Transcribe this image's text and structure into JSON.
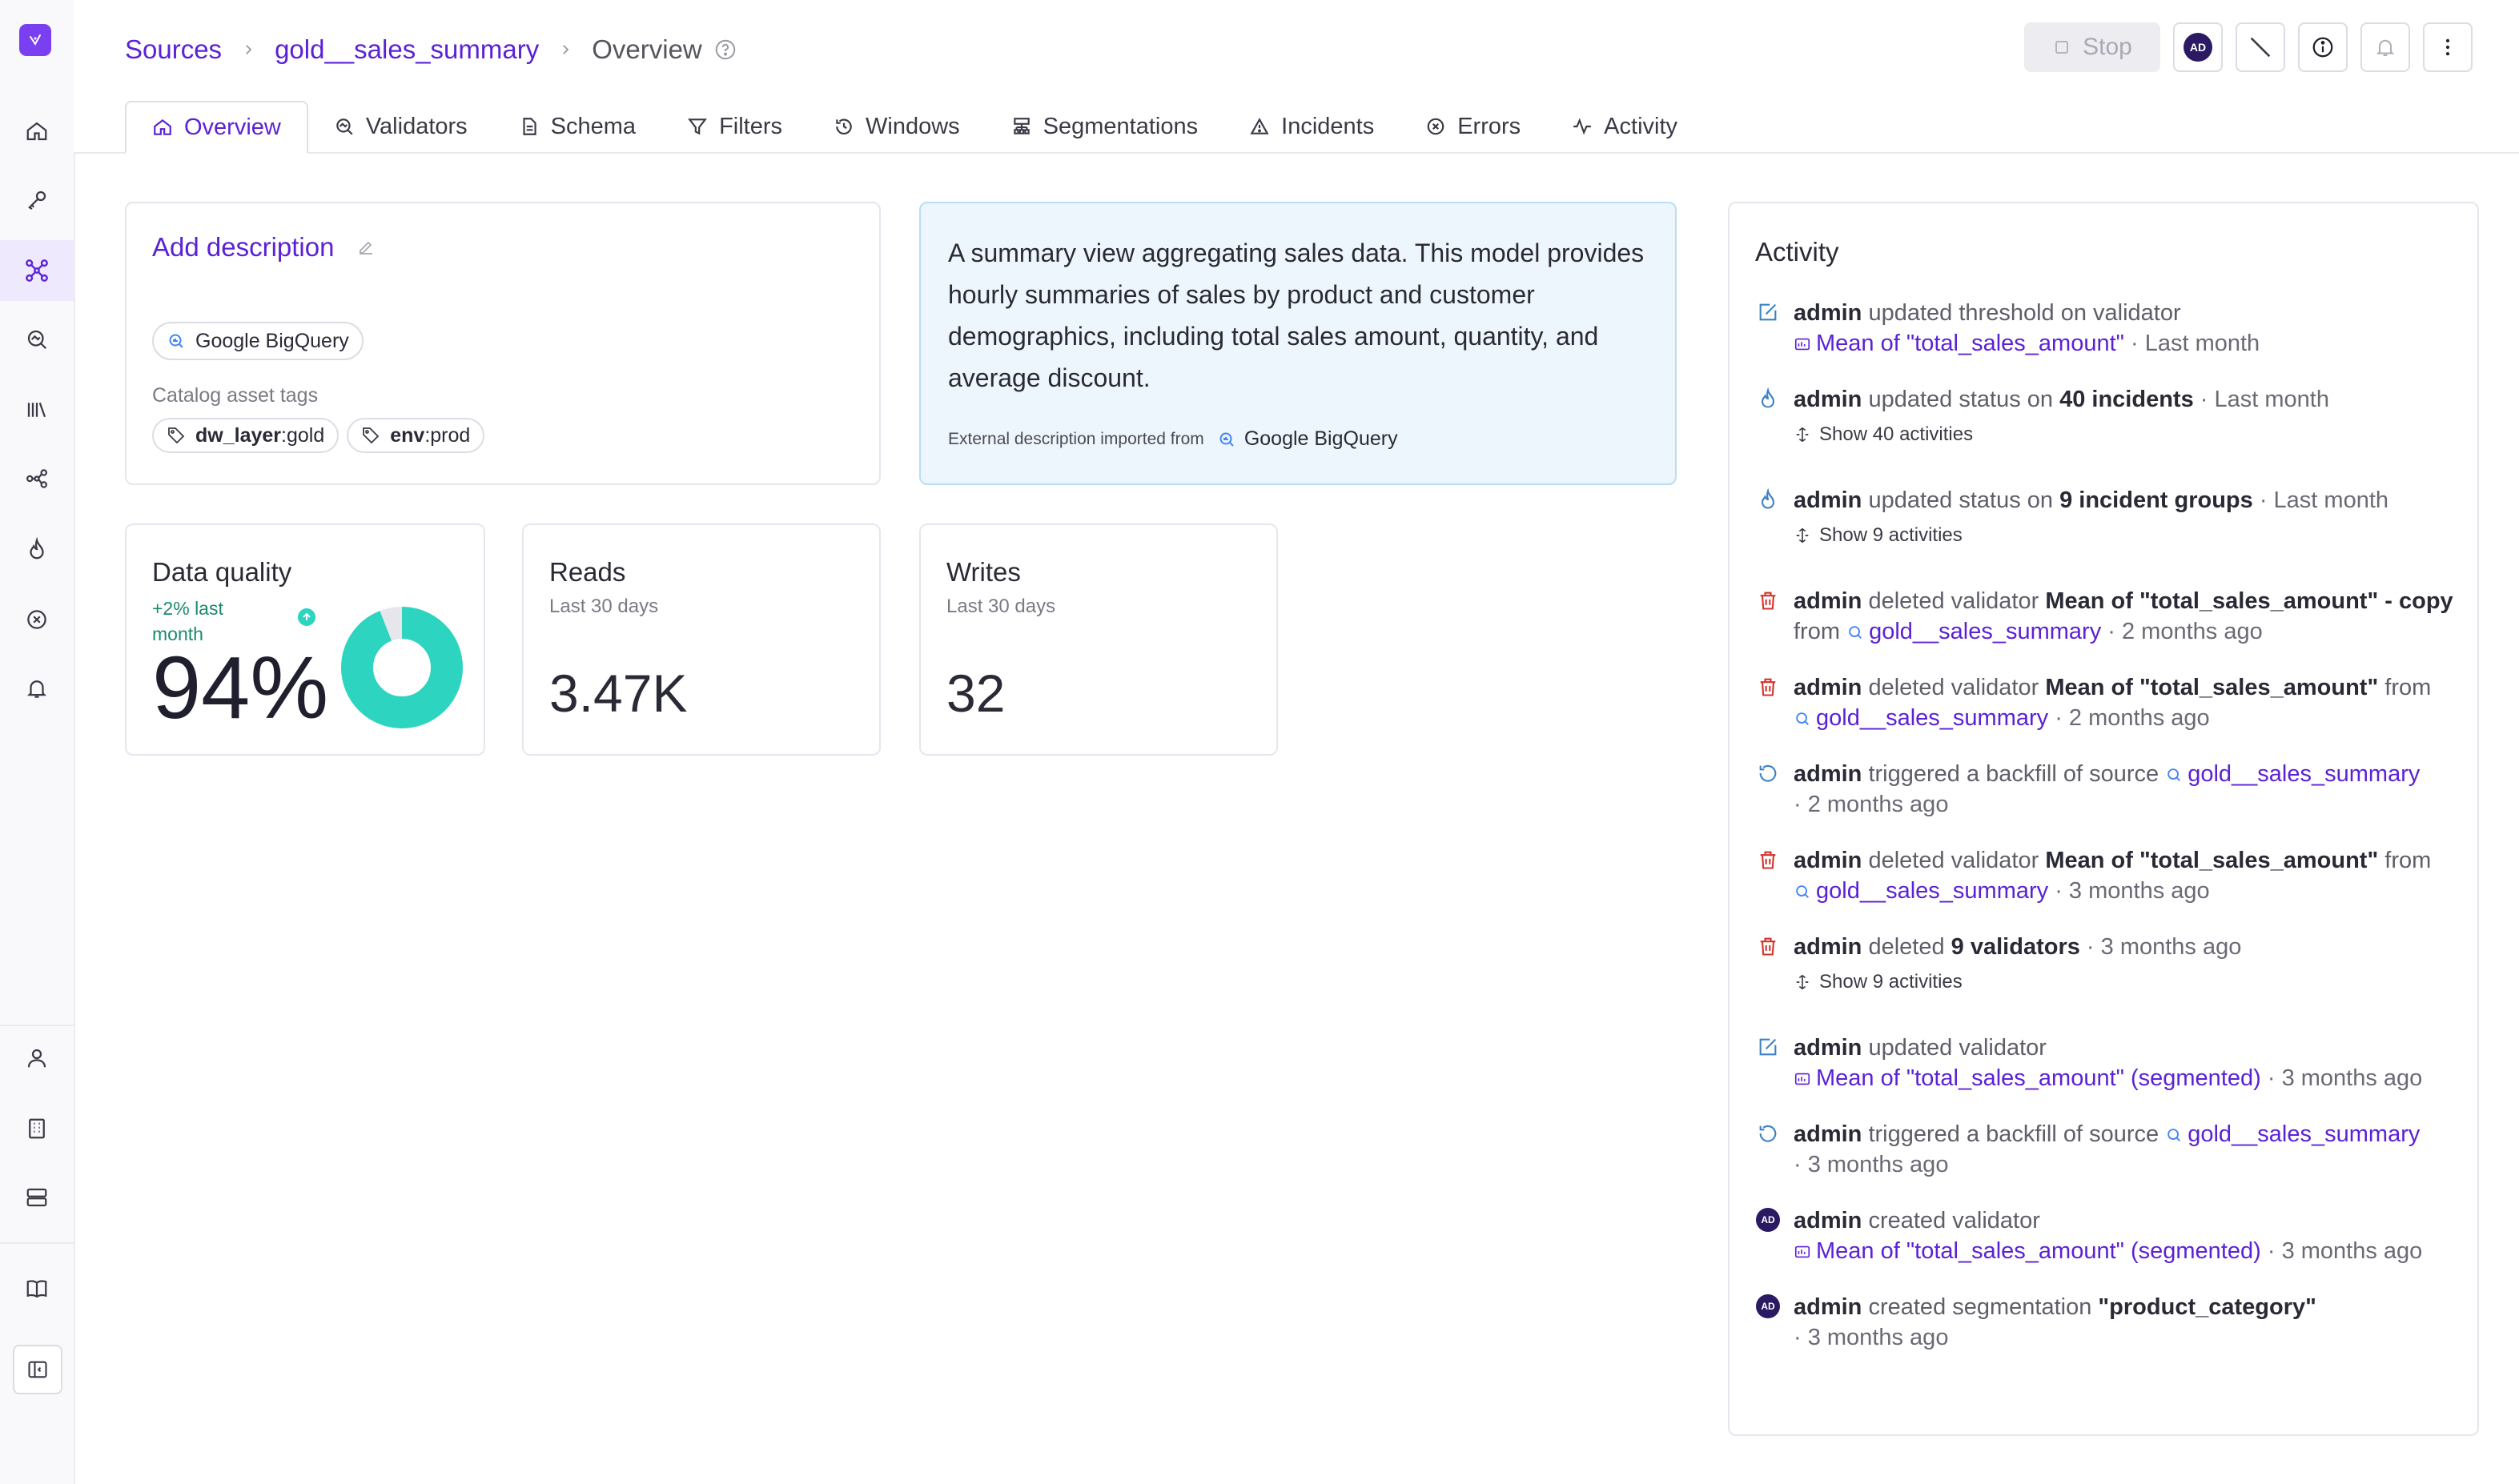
{
  "breadcrumb": {
    "root": "Sources",
    "source": "gold__sales_summary",
    "current": "Overview"
  },
  "header": {
    "stop_label": "Stop",
    "avatar_initials": "AD"
  },
  "tabs": [
    {
      "label": "Overview",
      "icon": "home-icon",
      "active": true
    },
    {
      "label": "Validators",
      "icon": "validator-icon"
    },
    {
      "label": "Schema",
      "icon": "schema-icon"
    },
    {
      "label": "Filters",
      "icon": "filter-icon"
    },
    {
      "label": "Windows",
      "icon": "windows-icon"
    },
    {
      "label": "Segmentations",
      "icon": "segmentation-icon"
    },
    {
      "label": "Incidents",
      "icon": "warning-icon"
    },
    {
      "label": "Errors",
      "icon": "error-icon"
    },
    {
      "label": "Activity",
      "icon": "activity-icon"
    }
  ],
  "description_card": {
    "add_label": "Add description",
    "source_chip": "Google BigQuery",
    "tags_label": "Catalog asset tags",
    "tags": [
      {
        "key": "dw_layer",
        "sep": ":",
        "value": "gold"
      },
      {
        "key": "env",
        "sep": ":",
        "value": "prod"
      }
    ]
  },
  "external_description": {
    "text": "A summary view aggregating sales data. This model provides hourly summaries of sales by product and customer demographics, including total sales amount, quantity, and average discount.",
    "imported_label": "External description imported from",
    "imported_source": "Google BigQuery"
  },
  "data_quality": {
    "title": "Data quality",
    "trend": "+2% last month",
    "value": "94%",
    "fraction": 0.94,
    "color": "#2dd4bf"
  },
  "reads": {
    "title": "Reads",
    "subtitle": "Last 30 days",
    "value": "3.47K"
  },
  "writes": {
    "title": "Writes",
    "subtitle": "Last 30 days",
    "value": "32"
  },
  "activity": {
    "title": "Activity",
    "items": {
      "a1": {
        "user": "admin",
        "action": " updated threshold on validator",
        "link": "Mean of \"total_sales_amount\"",
        "time": " · Last month"
      },
      "a2": {
        "user": "admin",
        "action": " updated status on ",
        "target": "40 incidents",
        "time": " · Last month",
        "show": "Show 40 activities"
      },
      "a3": {
        "user": "admin",
        "action": " updated status on ",
        "target": "9 incident groups",
        "time": " · Last month",
        "show": "Show 9 activities"
      },
      "a4": {
        "user": "admin",
        "action": " deleted validator ",
        "target": "Mean of \"total_sales_amount\" - copy",
        "from": "from ",
        "link": "gold__sales_summary",
        "time": " · 2 months ago"
      },
      "a5": {
        "user": "admin",
        "action": " deleted validator ",
        "target": "Mean of \"total_sales_amount\"",
        "from": " from",
        "link": "gold__sales_summary",
        "time": " · 2 months ago"
      },
      "a6": {
        "user": "admin",
        "action": " triggered a backfill of source ",
        "link": "gold__sales_summary",
        "time": "· 2 months ago"
      },
      "a7": {
        "user": "admin",
        "action": " deleted validator ",
        "target": "Mean of \"total_sales_amount\"",
        "from": " from",
        "link": "gold__sales_summary",
        "time": " · 3 months ago"
      },
      "a8": {
        "user": "admin",
        "action": " deleted ",
        "target": "9 validators",
        "time": " · 3 months ago",
        "show": "Show 9 activities"
      },
      "a9": {
        "user": "admin",
        "action": " updated validator",
        "link": "Mean of \"total_sales_amount\" (segmented)",
        "time": " · 3 months ago"
      },
      "a10": {
        "user": "admin",
        "action": " triggered a backfill of source ",
        "link": "gold__sales_summary",
        "time": "· 3 months ago"
      },
      "a11": {
        "user": "admin",
        "action": " created validator",
        "link": "Mean of \"total_sales_amount\" (segmented)",
        "time": " · 3 months ago",
        "avatar": "AD"
      },
      "a12": {
        "user": "admin",
        "action": " created segmentation ",
        "target": "\"product_category\"",
        "time": "· 3 months ago",
        "avatar": "AD"
      }
    }
  }
}
